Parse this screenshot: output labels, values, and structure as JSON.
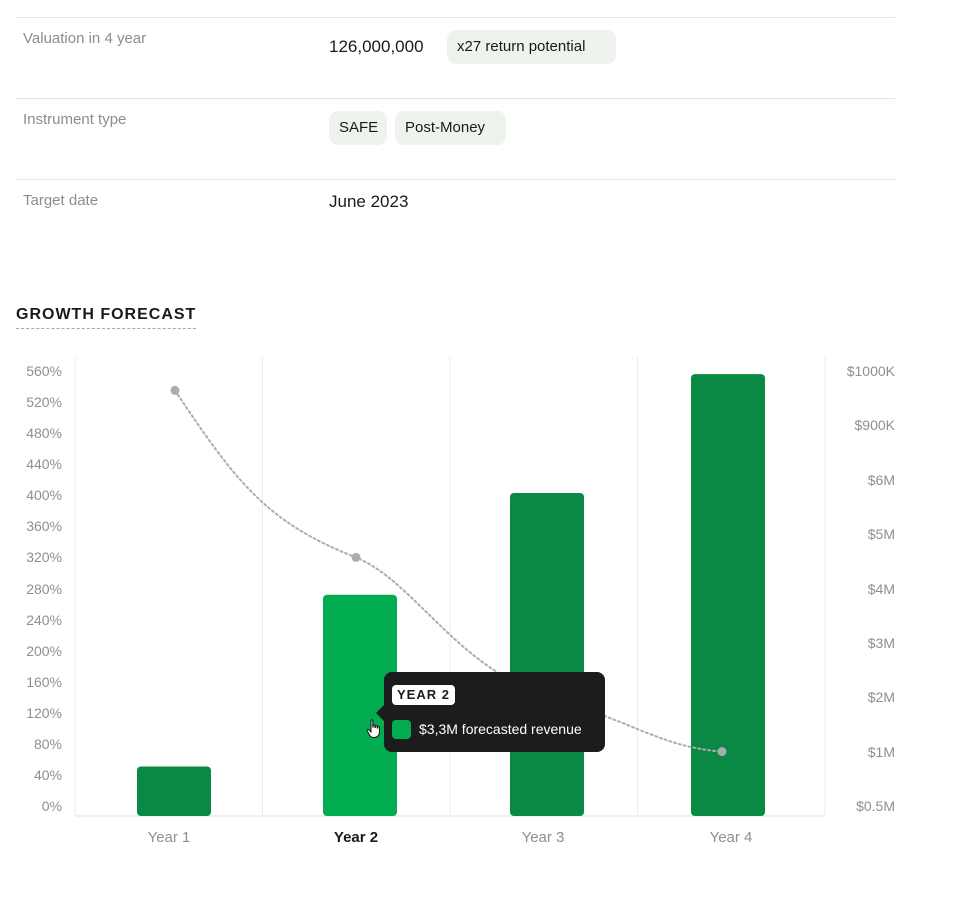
{
  "details": {
    "valuation": {
      "label": "Valuation in 4 year",
      "value": "126,000,000",
      "badge": "x27 return potential"
    },
    "instrument": {
      "label": "Instrument type",
      "badges": [
        "SAFE",
        "Post-Money"
      ]
    },
    "target": {
      "label": "Target date",
      "value": "June 2023"
    }
  },
  "section_title": "GROWTH FORECAST",
  "tooltip": {
    "title": "YEAR 2",
    "text": "$3,3M forecasted revenue"
  },
  "chart_data": {
    "type": "bar",
    "title": "GROWTH FORECAST",
    "categories": [
      "Year 1",
      "Year 2",
      "Year 3",
      "Year 4"
    ],
    "active_category": "Year 2",
    "left_ticks": [
      "560%",
      "520%",
      "480%",
      "440%",
      "400%",
      "360%",
      "320%",
      "280%",
      "240%",
      "200%",
      "160%",
      "120%",
      "80%",
      "40%",
      "0%"
    ],
    "right_ticks": [
      "$1000K",
      "$900K",
      "$6M",
      "$5M",
      "$4M",
      "$3M",
      "$2M",
      "$1M",
      "$0.5M"
    ],
    "bars": {
      "axis": "left",
      "values": [
        38,
        272,
        403,
        556
      ],
      "colors": [
        "#098943",
        "#02ad52",
        "#098943",
        "#098943"
      ]
    },
    "line": {
      "axis": "left",
      "style": "dotted",
      "color": "#a9aeaa",
      "x_positions": [
        "Year 1",
        "Year 2",
        "Year 4"
      ],
      "values": [
        535,
        320,
        70
      ]
    },
    "ylim_left": [
      0,
      560
    ],
    "grid": "vertical",
    "colors": {
      "bar": "#098943",
      "bar_active": "#02ad52",
      "line": "#a9aeaa"
    }
  }
}
